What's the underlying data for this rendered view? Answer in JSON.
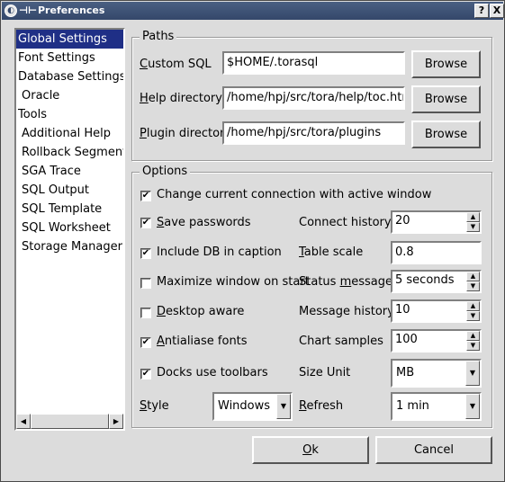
{
  "window": {
    "title": "Preferences",
    "help_button": "?",
    "close_button": "X"
  },
  "sidebar": {
    "items": [
      {
        "label": "Global Settings",
        "selected": true
      },
      {
        "label": "Font Settings"
      },
      {
        "label": "Database Settings"
      },
      {
        "label": "Oracle"
      },
      {
        "label": "Tools"
      },
      {
        "label": "Additional Help"
      },
      {
        "label": "Rollback Segments"
      },
      {
        "label": "SGA Trace"
      },
      {
        "label": "SQL Output"
      },
      {
        "label": "SQL Template"
      },
      {
        "label": "SQL Worksheet"
      },
      {
        "label": "Storage Manager"
      }
    ]
  },
  "paths": {
    "title": "Paths",
    "custom_sql": {
      "label_u": "C",
      "label_rest": "ustom SQL",
      "value": "$HOME/.torasql",
      "browse": "Browse"
    },
    "help_dir": {
      "label_u": "H",
      "label_rest": "elp directory",
      "value": "/home/hpj/src/tora/help/toc.htm",
      "browse": "Browse"
    },
    "plugin_dir": {
      "label_u": "P",
      "label_rest": "lugin directory",
      "value": "/home/hpj/src/tora/plugins",
      "browse": "Browse"
    }
  },
  "options": {
    "title": "Options",
    "change_connection": {
      "label": "Change current connection with active window",
      "checked": true
    },
    "save_passwords": {
      "label_u": "S",
      "label_rest": "ave passwords",
      "checked": true
    },
    "include_db": {
      "label": "Include DB in caption",
      "checked": true
    },
    "maximize": {
      "label": "Maximize window on start",
      "checked": false
    },
    "desktop_aware": {
      "label_u": "D",
      "label_rest": "esktop aware",
      "checked": false
    },
    "antialias": {
      "label_u": "A",
      "label_rest": "ntialiase fonts",
      "checked": true
    },
    "docks_toolbars": {
      "label": "Docks use toolbars",
      "checked": true
    },
    "style": {
      "label_u": "S",
      "label_rest": "tyle",
      "value": "Windows"
    },
    "connect_history": {
      "label": "Connect history",
      "value": "20"
    },
    "table_scale": {
      "label_u": "T",
      "label_rest": "able scale",
      "value": "0.8"
    },
    "status_message": {
      "label_pre": "Status ",
      "label_u": "m",
      "label_rest": "essage",
      "value": "5 seconds"
    },
    "message_history": {
      "label": "Message history",
      "value": "10"
    },
    "chart_samples": {
      "label": "Chart samples",
      "value": "100"
    },
    "size_unit": {
      "label": "Size Unit",
      "value": "MB"
    },
    "refresh": {
      "label_u": "R",
      "label_rest": "efresh",
      "value": "1 min"
    }
  },
  "buttons": {
    "ok_u": "O",
    "ok_rest": "k",
    "cancel": "Cancel"
  }
}
